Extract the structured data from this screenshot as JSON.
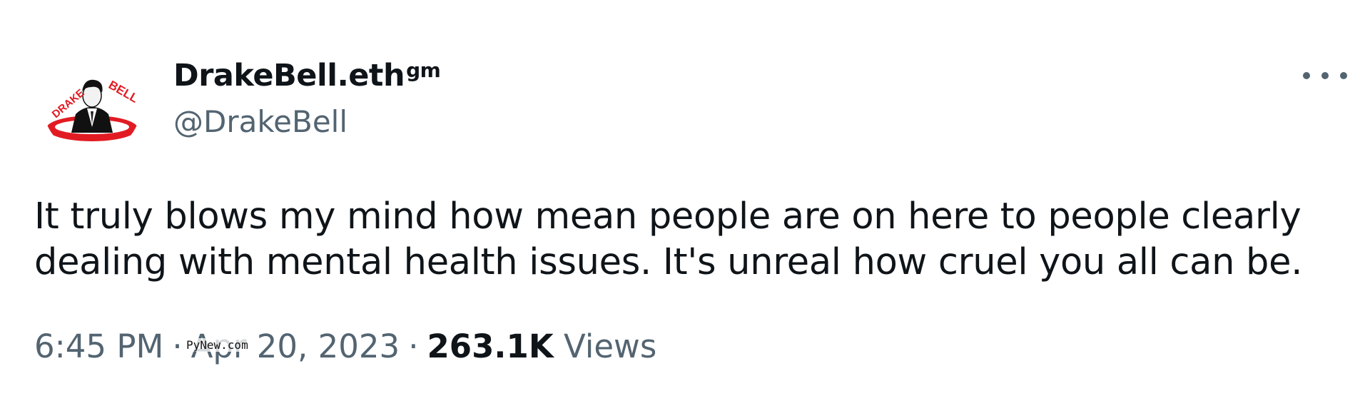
{
  "author": {
    "display_name": "DrakeBell.eth",
    "display_name_suffix": "gm",
    "handle": "@DrakeBell",
    "avatar_text_left": "DRAKE",
    "avatar_text_right": "BELL"
  },
  "menu": {
    "icon": "more-horizontal-icon"
  },
  "tweet": {
    "text_line_1": "It truly blows my mind how mean people are on here to people clearly",
    "text_line_2": "dealing with mental health issues. It's unreal how cruel you all can be."
  },
  "meta": {
    "time": "6:45 PM",
    "separator": "·",
    "date": "Apr 20, 2023",
    "views_count": "263.1K",
    "views_label": "Views"
  },
  "watermark": "PyNew.com",
  "colors": {
    "text_primary": "#0f1419",
    "text_secondary": "#536471",
    "avatar_red": "#e21b23"
  }
}
